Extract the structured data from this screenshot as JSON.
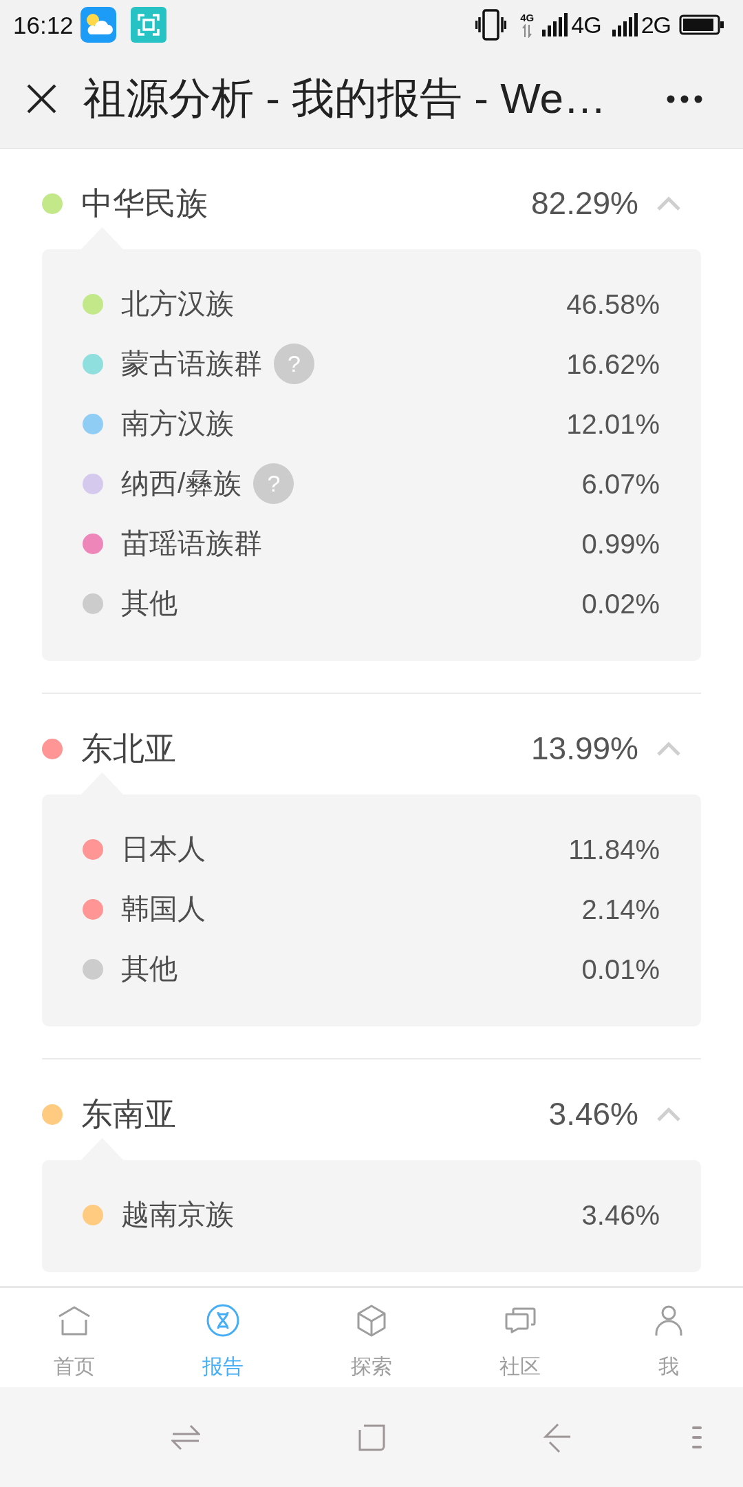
{
  "status_bar": {
    "time": "16:12",
    "data_indicator": "4G",
    "sim_1_network": "4G",
    "sim_2_network": "2G"
  },
  "header": {
    "title": "祖源分析 - 我的报告 - We…"
  },
  "groups": [
    {
      "name": "中华民族",
      "percent": "82.29%",
      "color": "#c3e88a",
      "expanded": true,
      "items": [
        {
          "name": "北方汉族",
          "percent": "46.58%",
          "color": "#c3e88a"
        },
        {
          "name": "蒙古语族群",
          "help": "?",
          "percent": "16.62%",
          "color": "#8fdfdf"
        },
        {
          "name": "南方汉族",
          "percent": "12.01%",
          "color": "#90cdf4"
        },
        {
          "name": "纳西/彝族",
          "help": "?",
          "percent": "6.07%",
          "color": "#d5c9ee"
        },
        {
          "name": "苗瑶语族群",
          "percent": "0.99%",
          "color": "#ee86b9"
        },
        {
          "name": "其他",
          "percent": "0.02%",
          "color": "#cccccc"
        }
      ]
    },
    {
      "name": "东北亚",
      "percent": "13.99%",
      "color": "#ff9595",
      "expanded": true,
      "items": [
        {
          "name": "日本人",
          "percent": "11.84%",
          "color": "#ff9595"
        },
        {
          "name": "韩国人",
          "percent": "2.14%",
          "color": "#ff9595"
        },
        {
          "name": "其他",
          "percent": "0.01%",
          "color": "#cccccc"
        }
      ]
    },
    {
      "name": "东南亚",
      "percent": "3.46%",
      "color": "#ffcb80",
      "expanded": true,
      "items": [
        {
          "name": "越南京族",
          "percent": "3.46%",
          "color": "#ffcb80"
        }
      ]
    }
  ],
  "tab_bar": {
    "tabs": [
      {
        "label": "首页",
        "selected": false
      },
      {
        "label": "报告",
        "selected": true
      },
      {
        "label": "探索",
        "selected": false
      },
      {
        "label": "社区",
        "selected": false
      },
      {
        "label": "我",
        "selected": false
      }
    ]
  }
}
